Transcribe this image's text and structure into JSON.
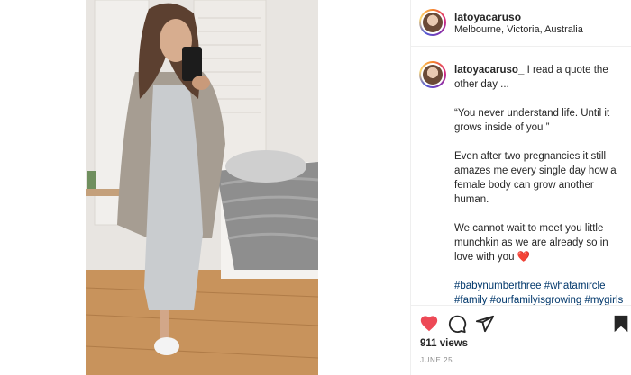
{
  "post": {
    "username": "latoyacaruso_",
    "location": "Melbourne, Victoria, Australia"
  },
  "caption": {
    "username": "latoyacaruso_",
    "line1": "I read a quote the other day ...",
    "line2": "“You never understand life. Until it grows inside of you ”",
    "line3": "Even after two pregnancies it still amazes me every single day how a female body can grow another human.",
    "line4": "We cannot wait to meet you little munchkin as we are already so in love with you",
    "emoji": "❤️",
    "hashtags": "#babynumberthree #whatamircle #family #ourfamilyisgrowing #mygirls #trulyblessed #soinlove #pregnant #22weekspregnant #itsajourney #fitmumma #pregnantmumma"
  },
  "stats": {
    "views": "911 views",
    "date": "JUNE 25"
  },
  "icons": {
    "like": "heart-icon",
    "comment": "comment-icon",
    "share": "share-icon",
    "save": "bookmark-icon"
  },
  "colors": {
    "like": "#ed4956",
    "hashtag": "#00376b",
    "text": "#262626",
    "muted": "#8e8e8e"
  }
}
